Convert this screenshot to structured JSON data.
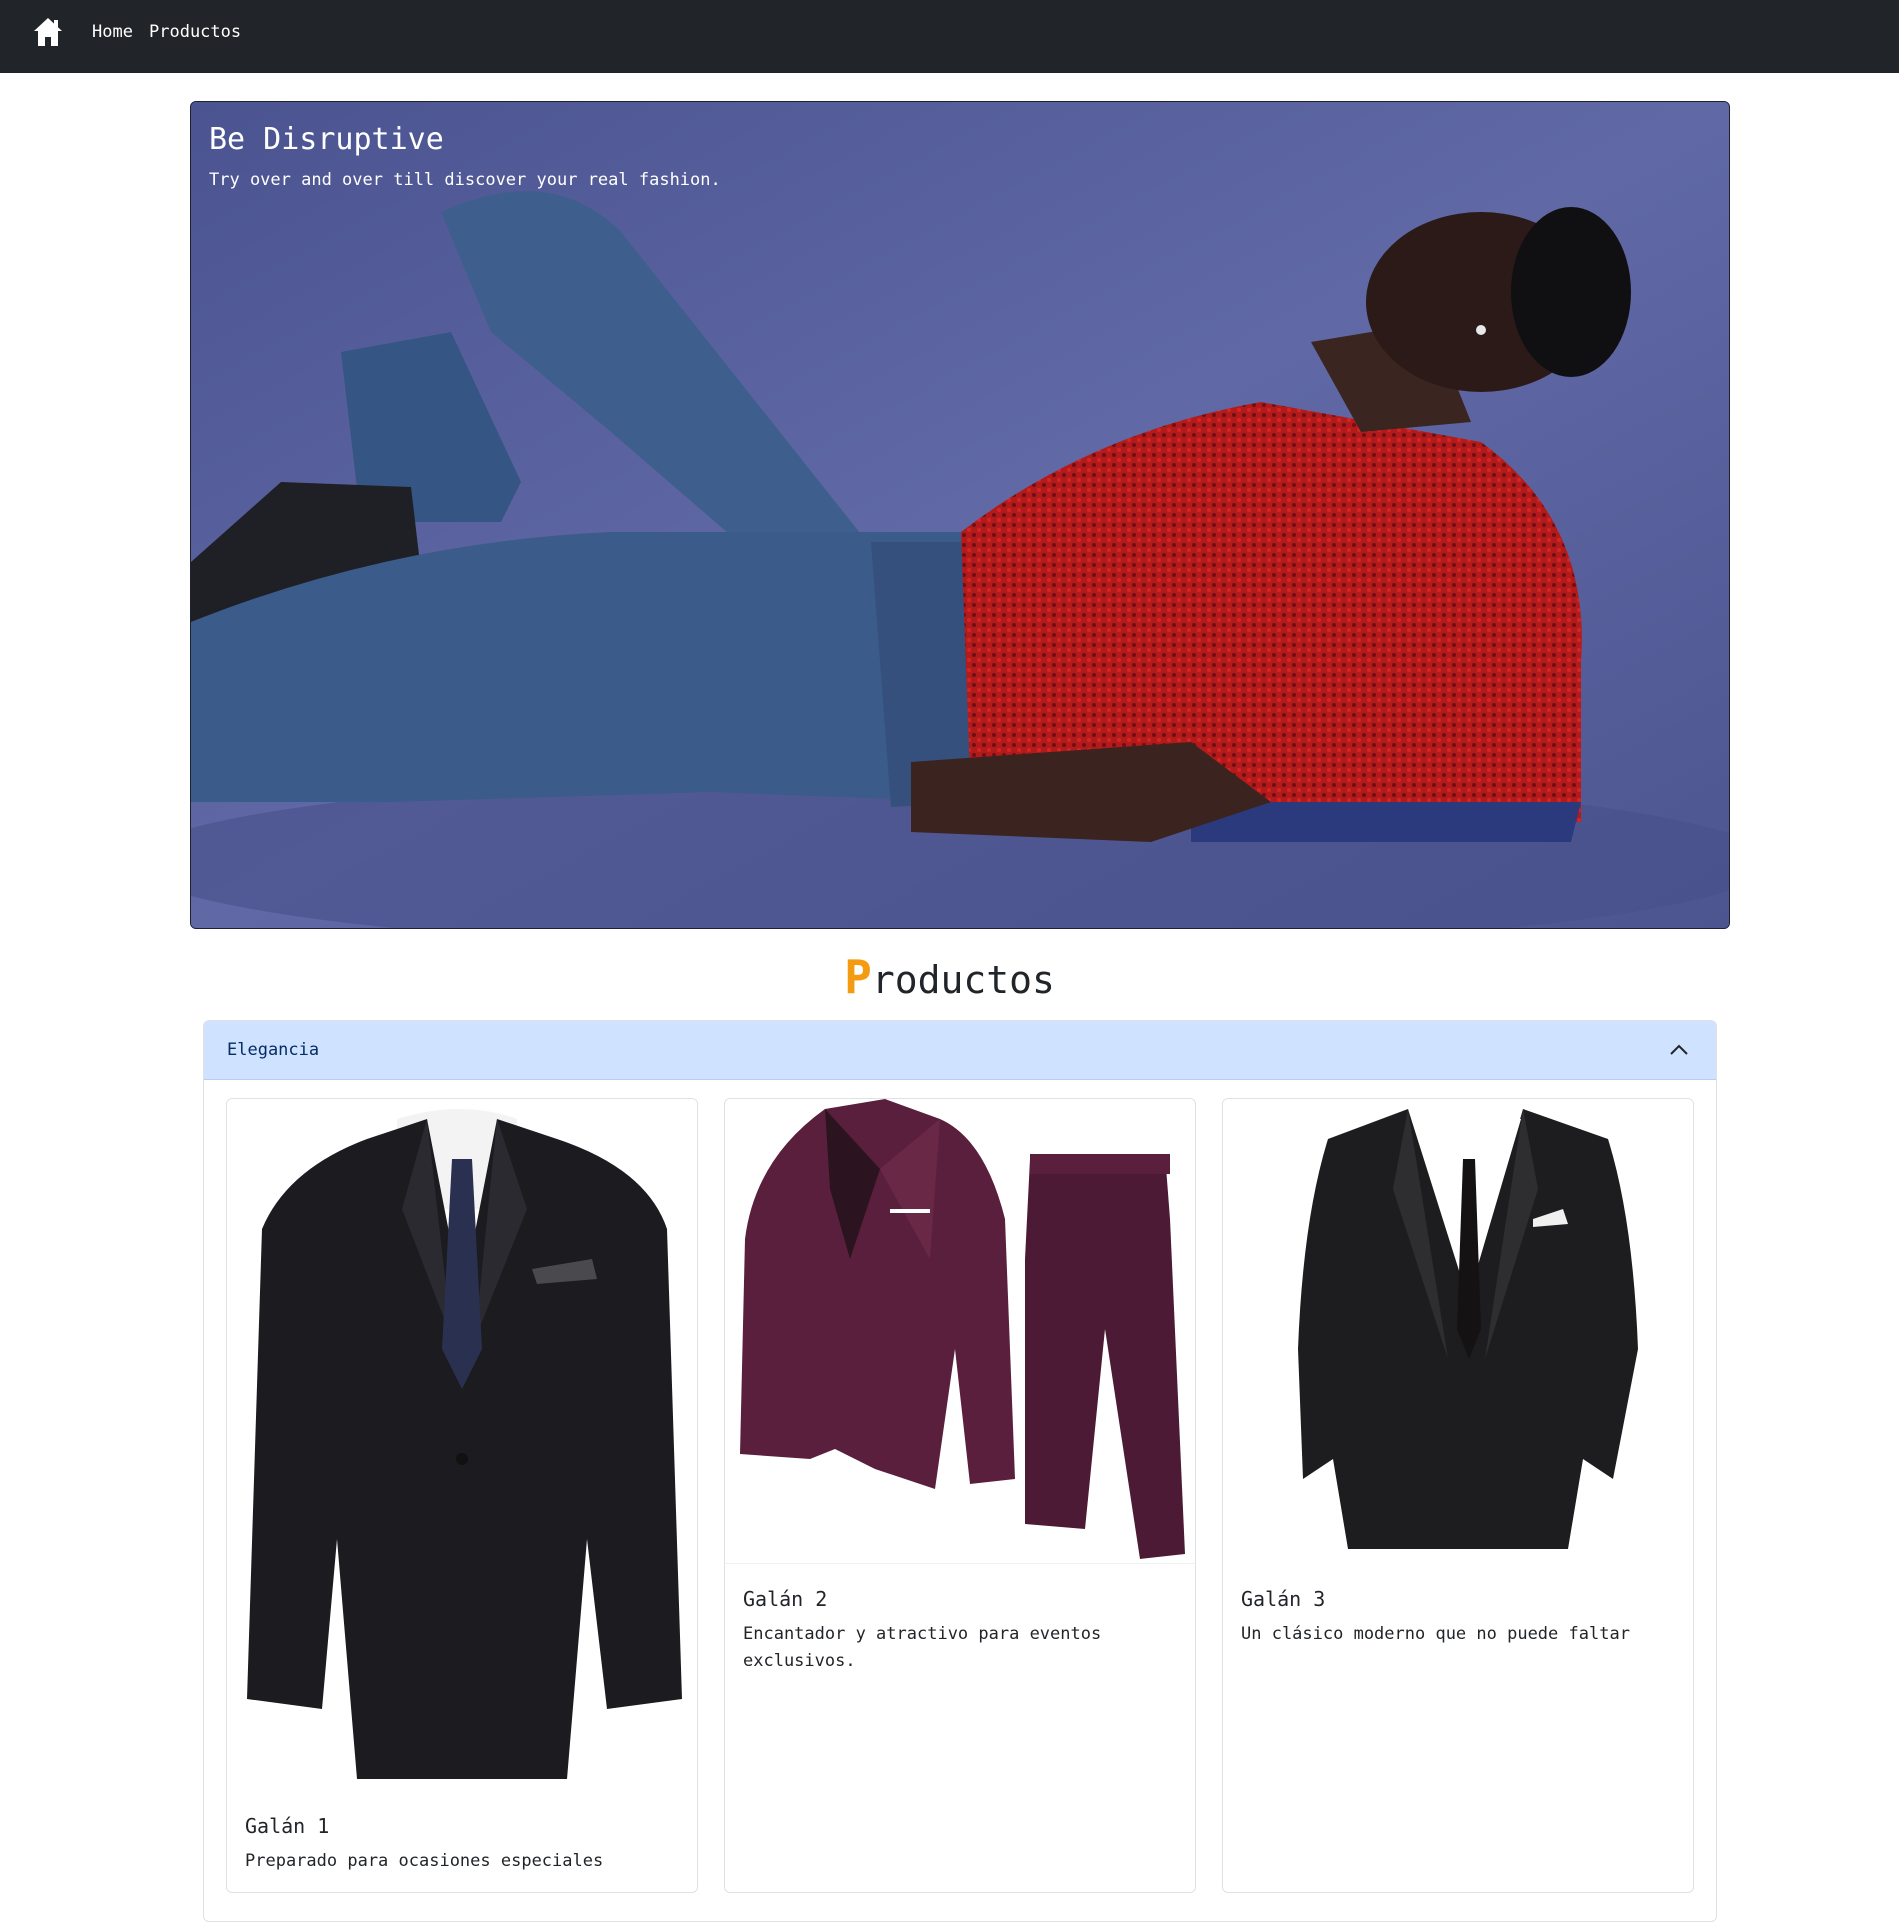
{
  "navbar": {
    "icon": "home-icon",
    "links": [
      "Home",
      "Productos"
    ]
  },
  "hero": {
    "title": "Be Disruptive",
    "subtitle": "Try over and over till discover your real fashion."
  },
  "section": {
    "title_first_letter": "P",
    "title_rest": "roductos",
    "accent_color": "#f39c12"
  },
  "accordion": {
    "header": "Elegancia",
    "icon": "chevron-up-icon",
    "header_bg": "#cfe2ff",
    "cards": [
      {
        "title": "Galán 1",
        "text": "Preparado para ocasiones especiales"
      },
      {
        "title": "Galán 2",
        "text": "Encantador y atractivo para eventos exclusivos."
      },
      {
        "title": "Galán 3",
        "text": "Un clásico moderno que no puede faltar"
      }
    ]
  }
}
